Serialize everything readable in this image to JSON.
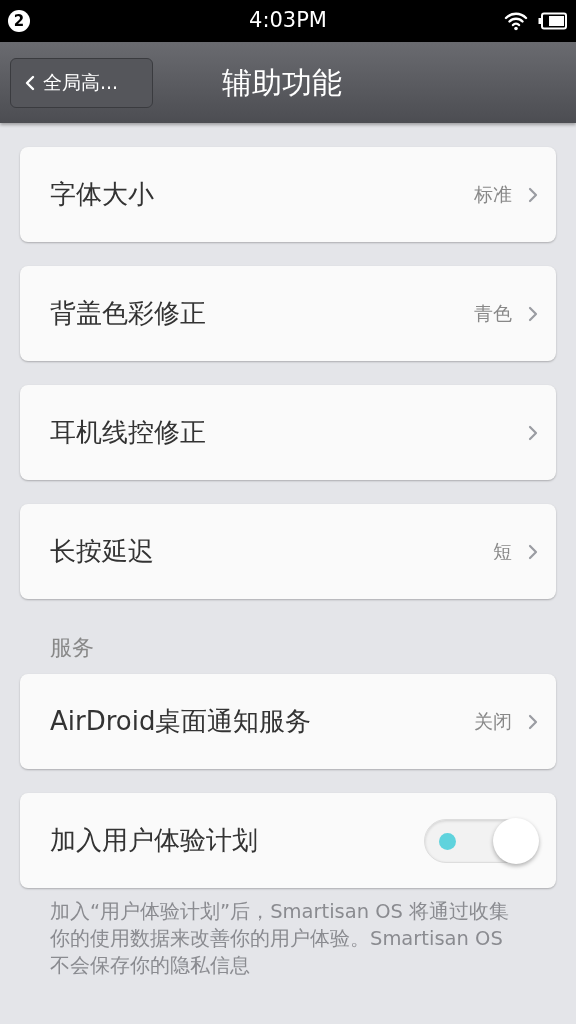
{
  "status_bar": {
    "notification_count": "2",
    "time": "4:03PM"
  },
  "nav_bar": {
    "back_label": "全局高...",
    "title": "辅助功能"
  },
  "groups": [
    {
      "items": [
        {
          "kind": "link",
          "label": "字体大小",
          "value": "标准"
        },
        {
          "kind": "link",
          "label": "背盖色彩修正",
          "value": "青色"
        },
        {
          "kind": "link",
          "label": "耳机线控修正"
        },
        {
          "kind": "link",
          "label": "长按延迟",
          "value": "短"
        }
      ]
    },
    {
      "header": "服务",
      "items": [
        {
          "kind": "link",
          "label": "AirDroid桌面通知服务",
          "value": "关闭"
        },
        {
          "kind": "toggle",
          "label": "加入用户体验计划",
          "on": true
        }
      ]
    }
  ],
  "footer": "加入“用户体验计划”后，Smartisan OS 将通过收集你的使用数据来改善你的用户体验。Smartisan OS 不会保存你的隐私信息"
}
